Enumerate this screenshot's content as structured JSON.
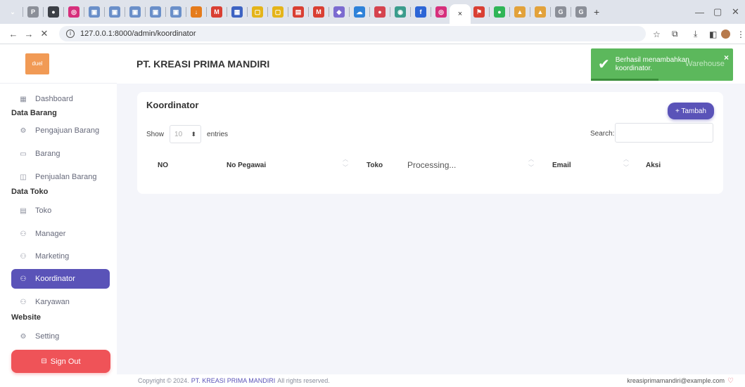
{
  "browser": {
    "tab_icons": [
      {
        "icon": "chevron-down-icon",
        "glyph": "⌄",
        "color": "#dfe3eb"
      },
      {
        "icon": "pdf-icon",
        "glyph": "P",
        "color": "#8b8f98"
      },
      {
        "icon": "github-icon",
        "glyph": "●",
        "color": "#3b3f46"
      },
      {
        "icon": "instagram-icon",
        "glyph": "◎",
        "color": "#d62f7c"
      },
      {
        "icon": "app-icon",
        "glyph": "▣",
        "color": "#6a8fc9"
      },
      {
        "icon": "app-icon",
        "glyph": "▣",
        "color": "#6a8fc9"
      },
      {
        "icon": "app-icon",
        "glyph": "▣",
        "color": "#6a8fc9"
      },
      {
        "icon": "app-icon",
        "glyph": "▣",
        "color": "#6a8fc9"
      },
      {
        "icon": "app-icon",
        "glyph": "▣",
        "color": "#6a8fc9"
      },
      {
        "icon": "download-icon",
        "glyph": "↓",
        "color": "#e57b1b"
      },
      {
        "icon": "gmail-icon",
        "glyph": "M",
        "color": "#d93f33"
      },
      {
        "icon": "app-icon",
        "glyph": "▦",
        "color": "#3d63c3"
      },
      {
        "icon": "app-icon",
        "glyph": "▢",
        "color": "#e4b419"
      },
      {
        "icon": "app-icon",
        "glyph": "▢",
        "color": "#e4b419"
      },
      {
        "icon": "app-icon",
        "glyph": "▤",
        "color": "#d93f33"
      },
      {
        "icon": "gmail-icon",
        "glyph": "M",
        "color": "#d93f33"
      },
      {
        "icon": "app-icon",
        "glyph": "◆",
        "color": "#7c6bd0"
      },
      {
        "icon": "cloud-icon",
        "glyph": "☁",
        "color": "#2f82d9"
      },
      {
        "icon": "app-icon",
        "glyph": "●",
        "color": "#d5434e"
      },
      {
        "icon": "app-icon",
        "glyph": "◉",
        "color": "#3a9c8c"
      },
      {
        "icon": "facebook-icon",
        "glyph": "f",
        "color": "#2c65d6"
      },
      {
        "icon": "instagram-icon",
        "glyph": "◎",
        "color": "#d62f7c"
      }
    ],
    "active_tab_close": "×",
    "tab_icons_right": [
      {
        "icon": "maps-icon",
        "glyph": "⚑",
        "color": "#d93f33"
      },
      {
        "icon": "whatsapp-icon",
        "glyph": "●",
        "color": "#2fb557"
      },
      {
        "icon": "drive-icon",
        "glyph": "▲",
        "color": "#e2a23b"
      },
      {
        "icon": "drive-icon",
        "glyph": "▲",
        "color": "#e2a23b"
      },
      {
        "icon": "google-icon",
        "glyph": "G",
        "color": "#8b8f98"
      },
      {
        "icon": "google-icon",
        "glyph": "G",
        "color": "#8b8f98"
      }
    ],
    "new_tab": "+",
    "url": "127.0.0.1:8000/admin/koordinator"
  },
  "sidebar": {
    "logo_text": "duel",
    "items": [
      {
        "id": "dashboard",
        "label": "Dashboard",
        "icon": "grid-icon",
        "glyph": "▦",
        "top": 0
      },
      {
        "id": "pengajuan-barang",
        "label": "Pengajuan Barang",
        "icon": "settings-icon",
        "glyph": "⚙"
      },
      {
        "id": "barang",
        "label": "Barang",
        "icon": "monitor-icon",
        "glyph": "▭"
      },
      {
        "id": "penjualan-barang",
        "label": "Penjualan Barang",
        "icon": "screen-icon",
        "glyph": "◫"
      },
      {
        "id": "toko",
        "label": "Toko",
        "icon": "store-icon",
        "glyph": "▤"
      },
      {
        "id": "manager",
        "label": "Manager",
        "icon": "users-icon",
        "glyph": "👥"
      },
      {
        "id": "marketing",
        "label": "Marketing",
        "icon": "users-icon",
        "glyph": "👥"
      },
      {
        "id": "koordinator",
        "label": "Koordinator",
        "icon": "users-icon",
        "glyph": "👥"
      },
      {
        "id": "karyawan",
        "label": "Karyawan",
        "icon": "users-icon",
        "glyph": "👥"
      },
      {
        "id": "setting",
        "label": "Setting",
        "icon": "gear-icon",
        "glyph": "⚙"
      }
    ],
    "sections": {
      "data_barang": "Data Barang",
      "data_toko": "Data Toko",
      "website": "Website"
    },
    "signout_label": "Sign Out"
  },
  "header": {
    "company": "PT. KREASI PRIMA MANDIRI"
  },
  "toast": {
    "message": "Berhasil menambahkan koordinator.",
    "behind_text": "Warehouse",
    "close": "×",
    "color": "#5cb85c"
  },
  "card": {
    "title": "Koordinator",
    "add_label": "+ Tambah",
    "show_label": "Show",
    "entries_value": "10",
    "entries_label": "entries",
    "search_label": "Search:",
    "search_value": "",
    "columns": [
      "NO",
      "No Pegawai",
      "Toko",
      "Email",
      "Aksi"
    ],
    "processing": "Processing..."
  },
  "footer": {
    "copyright_prefix": "Copyright © 2024.",
    "brand": "PT. KREASI PRIMA MANDIRI",
    "copyright_suffix": "All rights reserved.",
    "email": "kreasiprimamandiri@example.com"
  },
  "accent": "#5a53b8",
  "danger": "#ef5358"
}
